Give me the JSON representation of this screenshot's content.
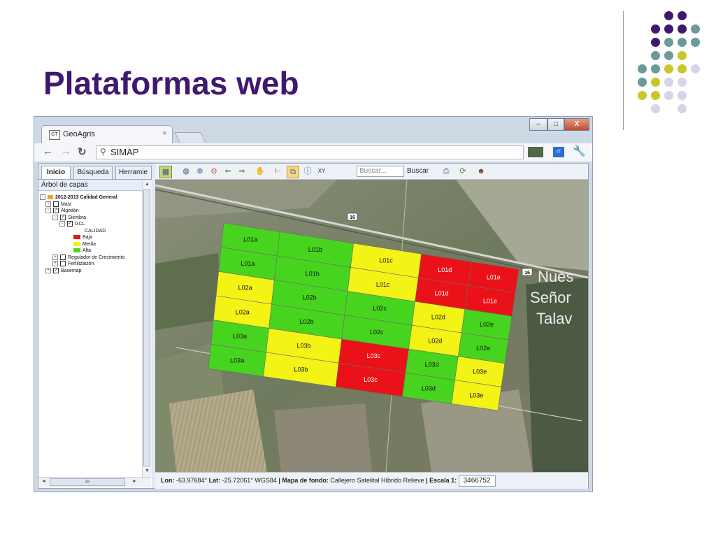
{
  "slide": {
    "title": "Plataformas web"
  },
  "colors": {
    "purple": "#3f1870",
    "teal": "#6c9a99",
    "olive": "#c9c52a",
    "lavender": "#d6d4e6"
  },
  "browser": {
    "tab_title": "GeoAgris",
    "tab_close": "×",
    "favicon": "GT",
    "url": "SIMAP",
    "window_controls": [
      "–",
      "□",
      "X"
    ]
  },
  "left_panel": {
    "tabs": [
      "Inicio",
      "Búsqueda",
      "Herramie"
    ],
    "header": "Árbol de capas",
    "tree": {
      "root": "2012-2013 Calidad General",
      "maiz": "Maíz",
      "algodon": "Algodón",
      "siembra": "Siembra",
      "gcl": "GCL",
      "calidad": "CALIDAD",
      "legend": [
        {
          "label": "Baja",
          "color": "#e8141b"
        },
        {
          "label": "Media",
          "color": "#f2f21a"
        },
        {
          "label": "Alta",
          "color": "#4cd81f"
        }
      ],
      "regulador": "Regulador de Crecimiento",
      "fertilizacion": "Fertilización",
      "basemap": "Basemap"
    },
    "hscroll_thumb": "III"
  },
  "map_toolbar": {
    "search_placeholder": "Buscar...",
    "search_button": "Buscar"
  },
  "map": {
    "road_label": "16",
    "place_labels": [
      "Nues",
      "Señor",
      "Talav"
    ],
    "plots": [
      {
        "label": "L01a",
        "color": "green"
      },
      {
        "label": "L01b",
        "color": "green"
      },
      {
        "label": "L01c",
        "color": "yellow"
      },
      {
        "label": "L01d",
        "color": "red"
      },
      {
        "label": "L01e",
        "color": "red"
      },
      {
        "label": "L01a",
        "color": "green"
      },
      {
        "label": "L01b",
        "color": "green"
      },
      {
        "label": "L01c",
        "color": "yellow"
      },
      {
        "label": "L01d",
        "color": "red"
      },
      {
        "label": "L01e",
        "color": "red"
      },
      {
        "label": "L02a",
        "color": "yellow"
      },
      {
        "label": "L02b",
        "color": "green"
      },
      {
        "label": "L02c",
        "color": "green"
      },
      {
        "label": "L02d",
        "color": "yellow"
      },
      {
        "label": "L02e",
        "color": "green"
      },
      {
        "label": "L02a",
        "color": "yellow"
      },
      {
        "label": "L02b",
        "color": "green"
      },
      {
        "label": "L02c",
        "color": "green"
      },
      {
        "label": "L02d",
        "color": "yellow"
      },
      {
        "label": "L02e",
        "color": "green"
      },
      {
        "label": "L03a",
        "color": "green"
      },
      {
        "label": "L03b",
        "color": "yellow"
      },
      {
        "label": "L03c",
        "color": "red"
      },
      {
        "label": "L03d",
        "color": "green"
      },
      {
        "label": "L03e",
        "color": "yellow"
      },
      {
        "label": "L03a",
        "color": "green"
      },
      {
        "label": "L03b",
        "color": "yellow"
      },
      {
        "label": "L03c",
        "color": "red"
      },
      {
        "label": "L03d",
        "color": "green"
      },
      {
        "label": "L03e",
        "color": "yellow"
      }
    ]
  },
  "status_bar": {
    "lon_label": "Lon:",
    "lon": "-63.97684°",
    "lat_label": "Lat:",
    "lat": "-25.72061°",
    "crs": "WGS84",
    "basemap_label": "| Mapa de fondo:",
    "basemaps": [
      "Callejero",
      "Satelital",
      "Híbrido",
      "Relieve"
    ],
    "scale_label": "| Escala 1:",
    "scale": "3466752"
  }
}
